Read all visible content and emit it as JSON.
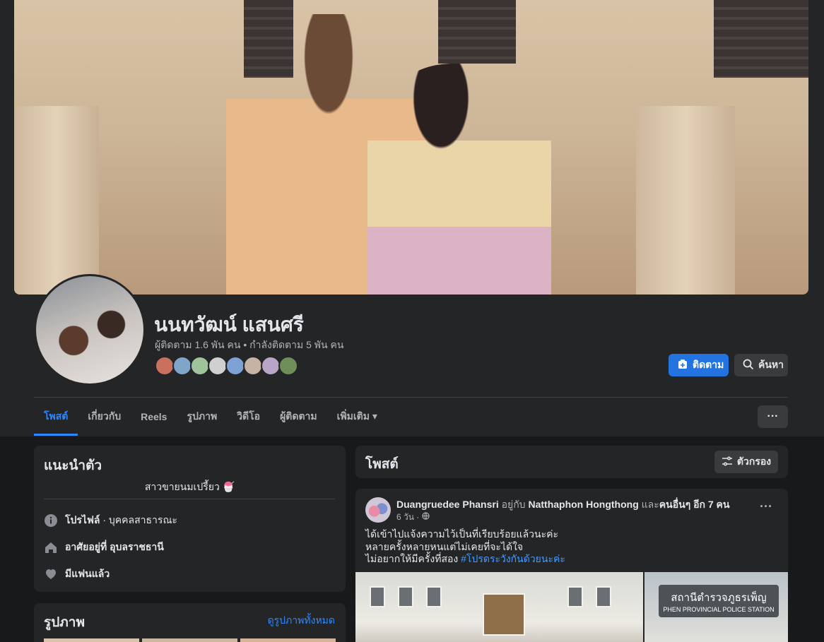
{
  "profile": {
    "name": "นนทวัฒน์ แสนศรี",
    "stats": "ผู้ติดตาม 1.6 พัน คน • กำลังติดตาม 5 พัน คน",
    "follow_label": "ติดตาม",
    "search_label": "ค้นหา",
    "follower_avatar_colors": [
      "#c9705f",
      "#7fa6c9",
      "#9fc49a",
      "#d0d0d0",
      "#7da3d6",
      "#c7b3a3",
      "#b9a6c7",
      "#6f8f5a"
    ]
  },
  "tabs": [
    {
      "label": "โพสต์",
      "active": true
    },
    {
      "label": "เกี่ยวกับ",
      "active": false
    },
    {
      "label": "Reels",
      "active": false
    },
    {
      "label": "รูปภาพ",
      "active": false
    },
    {
      "label": "วิดีโอ",
      "active": false
    },
    {
      "label": "ผู้ติดตาม",
      "active": false
    },
    {
      "label": "เพิ่มเติม ▾",
      "active": false
    }
  ],
  "intro": {
    "title": "แนะนำตัว",
    "bio": "สาวขายนมเปรี้ยว 🍧",
    "profile_label": "โปรไฟล์",
    "profile_type": " · บุคคลสาธารณะ",
    "lives_in": "อาศัยอยู่ที่ อุบลราชธานี",
    "relationship": "มีแฟนแล้ว"
  },
  "photos": {
    "title": "รูปภาพ",
    "see_all": "ดูรูปภาพทั้งหมด"
  },
  "posts": {
    "title": "โพสต์",
    "filter_label": "ตัวกรอง"
  },
  "post": {
    "author": "Duangruedee Phansri",
    "with_text": " อยู่กับ ",
    "tagged": "Natthaphon Hongthong",
    "and_text": " และ",
    "others": "คนอื่นๆ อีก 7 คน",
    "time": "6 วัน ·",
    "line1": "ได้เข้าไปแจ้งความไว้เป็นที่เรียบร้อยแล้วนะค่ะ",
    "line2": "หลายครั้งหลายหนแต่ไม่เคยที่จะได้ใจ",
    "line3": "ไม่อยากให้มีครั้งที่สอง ",
    "hashtag": "#โปรดระวังกันด้วยนะค่ะ",
    "sign_th": "สถานีตำรวจภูธรเพ็ญ",
    "sign_en": "PHEN PROVINCIAL POLICE STATION"
  }
}
